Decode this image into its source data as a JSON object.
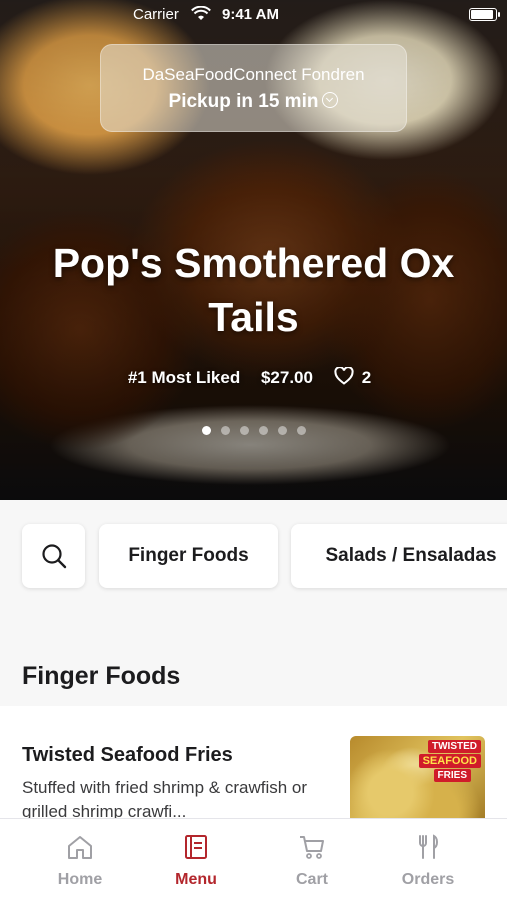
{
  "status_bar": {
    "carrier": "Carrier",
    "time": "9:41 AM",
    "battery_level": 0.95
  },
  "store": {
    "name": "DaSeaFoodConnect Fondren",
    "pickup": "Pickup in 15 min"
  },
  "featured": {
    "title": "Pop's Smothered Ox Tails",
    "badge": "#1 Most Liked",
    "price": "$27.00",
    "likes": "2",
    "carousel_pages": 6,
    "carousel_active": 1
  },
  "categories": {
    "search_icon": "search-icon",
    "items": [
      "Finger Foods",
      "Salads / Ensaladas"
    ]
  },
  "section": {
    "title": "Finger Foods"
  },
  "menu_items": [
    {
      "name": "Twisted Seafood Fries",
      "description": "Stuffed with fried shrimp & crawfish or grilled shrimp crawfi...",
      "image_text": [
        "TWISTED",
        "SEAFOOD",
        "FRIES"
      ]
    }
  ],
  "tabs": [
    {
      "label": "Home",
      "icon": "home-icon",
      "active": false
    },
    {
      "label": "Menu",
      "icon": "menu-book-icon",
      "active": true
    },
    {
      "label": "Cart",
      "icon": "cart-icon",
      "active": false
    },
    {
      "label": "Orders",
      "icon": "fork-knife-icon",
      "active": false
    }
  ],
  "colors": {
    "accent": "#b3262c",
    "inactive": "#a0a0a5"
  }
}
